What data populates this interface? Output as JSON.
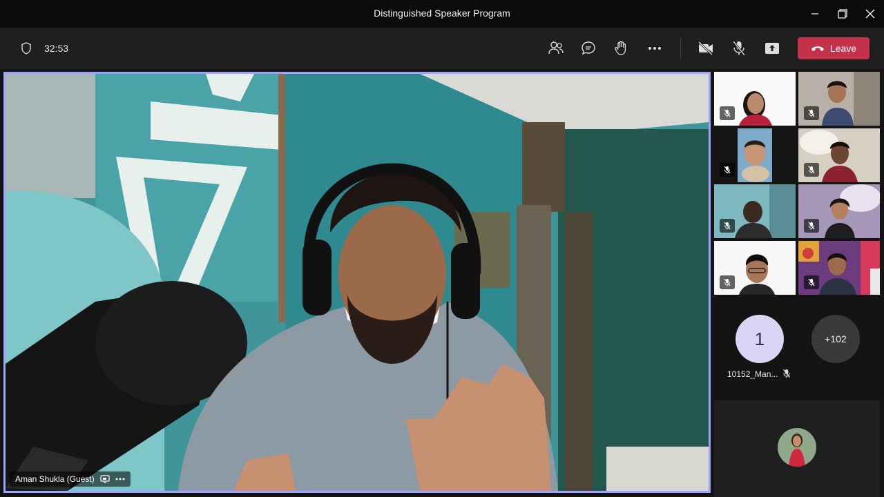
{
  "window": {
    "title": "Distinguished Speaker Program"
  },
  "meeting": {
    "elapsed": "32:53"
  },
  "toolbar": {
    "leave_label": "Leave",
    "icons": [
      "people-icon",
      "chat-icon",
      "raise-hand-icon",
      "more-icon",
      "camera-off-icon",
      "mic-off-icon",
      "share-icon"
    ]
  },
  "stage": {
    "speaker_name": "Aman Shukla (Guest)"
  },
  "participants": {
    "gallery_count": 8,
    "all_muted": true
  },
  "overflow": {
    "avatar_initial": "1",
    "avatar_name": "10152_Man...",
    "more_count": "+102"
  },
  "colors": {
    "leave_button": "#c4314b",
    "active_speaker_border": "#9ea2ff"
  }
}
